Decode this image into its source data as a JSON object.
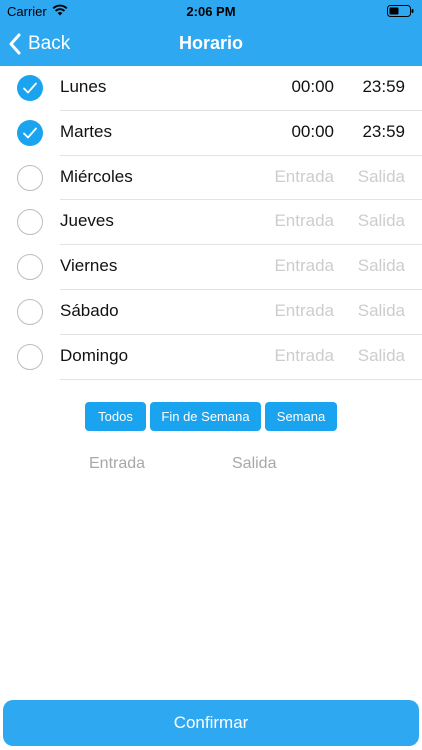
{
  "status_bar": {
    "carrier": "Carrier",
    "time": "2:06 PM"
  },
  "nav": {
    "back_label": "Back",
    "title": "Horario"
  },
  "days": [
    {
      "label": "Lunes",
      "checked": true,
      "entry": "00:00",
      "exit": "23:59",
      "entry_is_placeholder": false,
      "exit_is_placeholder": false
    },
    {
      "label": "Martes",
      "checked": true,
      "entry": "00:00",
      "exit": "23:59",
      "entry_is_placeholder": false,
      "exit_is_placeholder": false
    },
    {
      "label": "Miércoles",
      "checked": false,
      "entry": "Entrada",
      "exit": "Salida",
      "entry_is_placeholder": true,
      "exit_is_placeholder": true
    },
    {
      "label": "Jueves",
      "checked": false,
      "entry": "Entrada",
      "exit": "Salida",
      "entry_is_placeholder": true,
      "exit_is_placeholder": true
    },
    {
      "label": "Viernes",
      "checked": false,
      "entry": "Entrada",
      "exit": "Salida",
      "entry_is_placeholder": true,
      "exit_is_placeholder": true
    },
    {
      "label": "Sábado",
      "checked": false,
      "entry": "Entrada",
      "exit": "Salida",
      "entry_is_placeholder": true,
      "exit_is_placeholder": true
    },
    {
      "label": "Domingo",
      "checked": false,
      "entry": "Entrada",
      "exit": "Salida",
      "entry_is_placeholder": true,
      "exit_is_placeholder": true
    }
  ],
  "filters": {
    "all": "Todos",
    "weekend": "Fin de Semana",
    "week": "Semana"
  },
  "time_fields": {
    "entry_placeholder": "Entrada",
    "exit_placeholder": "Salida"
  },
  "confirm_label": "Confirmar",
  "colors": {
    "accent": "#1aa3ee",
    "header": "#2fa8f2",
    "placeholder": "#cdcdcd"
  }
}
